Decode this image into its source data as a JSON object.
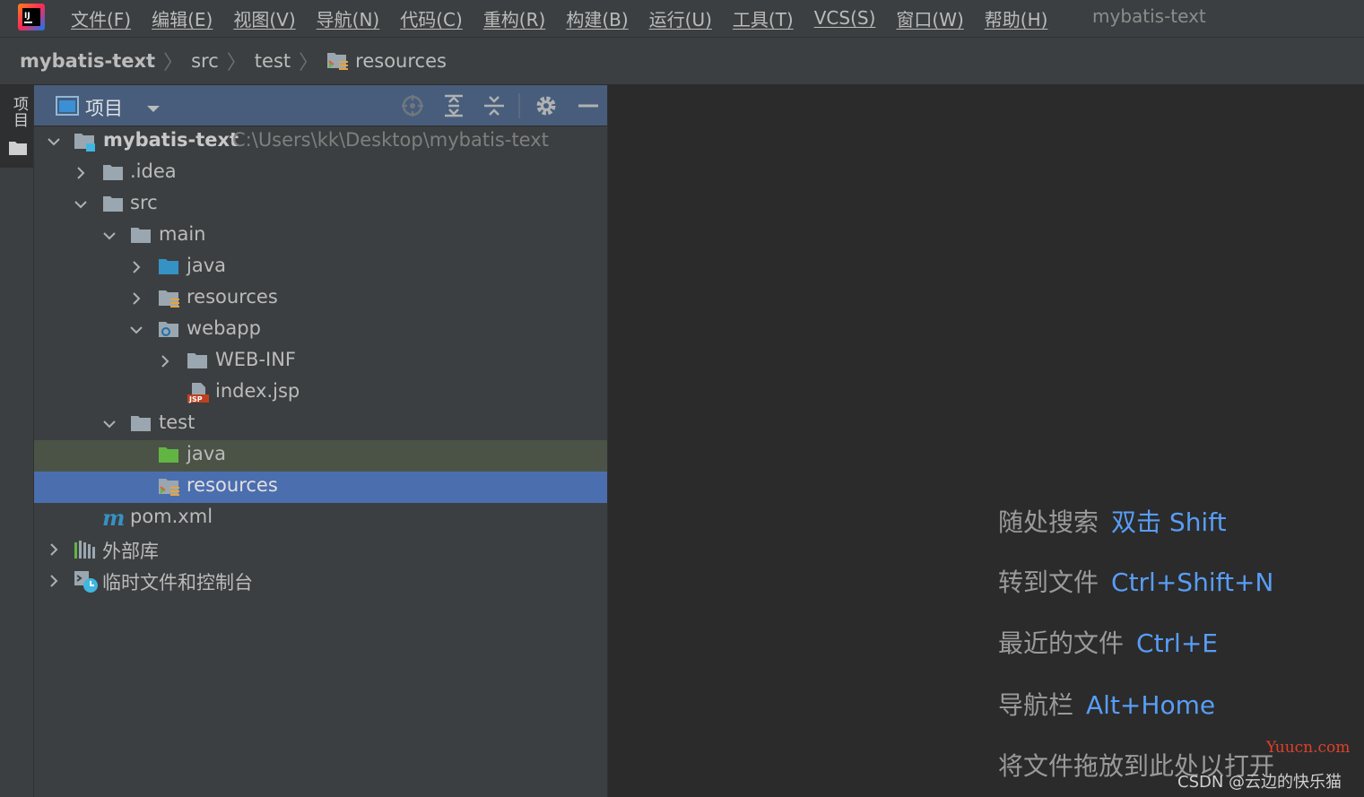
{
  "menubar": {
    "items": [
      "文件(F)",
      "编辑(E)",
      "视图(V)",
      "导航(N)",
      "代码(C)",
      "重构(R)",
      "构建(B)",
      "运行(U)",
      "工具(T)",
      "VCS(S)",
      "窗口(W)",
      "帮助(H)"
    ],
    "window_title": "mybatis-text"
  },
  "breadcrumb": {
    "items": [
      "mybatis-text",
      "src",
      "test",
      "resources"
    ]
  },
  "tool_stripe": {
    "project_label": "项目"
  },
  "project_panel": {
    "title": "项目",
    "tree": [
      {
        "label": "mybatis-text",
        "path": "C:\\Users\\kk\\Desktop\\mybatis-text",
        "icon": "module-folder-icon",
        "expanded": true
      },
      {
        "label": ".idea",
        "icon": "folder-icon",
        "expanded": false
      },
      {
        "label": "src",
        "icon": "folder-icon",
        "expanded": true
      },
      {
        "label": "main",
        "icon": "folder-icon",
        "expanded": true
      },
      {
        "label": "java",
        "icon": "source-folder-icon",
        "expanded": false
      },
      {
        "label": "resources",
        "icon": "resources-folder-icon",
        "expanded": false
      },
      {
        "label": "webapp",
        "icon": "web-folder-icon",
        "expanded": true
      },
      {
        "label": "WEB-INF",
        "icon": "folder-icon",
        "expanded": false
      },
      {
        "label": "index.jsp",
        "icon": "jsp-file-icon"
      },
      {
        "label": "test",
        "icon": "folder-icon",
        "expanded": true
      },
      {
        "label": "java",
        "icon": "test-source-folder-icon",
        "state": "highlighted"
      },
      {
        "label": "resources",
        "icon": "test-resources-folder-icon",
        "state": "selected"
      },
      {
        "label": "pom.xml",
        "icon": "maven-icon"
      },
      {
        "label": "外部库",
        "icon": "library-icon",
        "expanded": false
      },
      {
        "label": "临时文件和控制台",
        "icon": "scratches-icon",
        "expanded": false
      }
    ]
  },
  "editor_hints": [
    {
      "label": "随处搜索",
      "key": "双击 Shift"
    },
    {
      "label": "转到文件",
      "key": "Ctrl+Shift+N"
    },
    {
      "label": "最近的文件",
      "key": "Ctrl+E"
    },
    {
      "label": "导航栏",
      "key": "Alt+Home"
    },
    {
      "label": "将文件拖放到此处以打开",
      "key": ""
    }
  ],
  "watermarks": {
    "site": "Yuucn.com",
    "author": "CSDN @云边的快乐猫"
  },
  "colors": {
    "selection": "#4b6eaf",
    "highlight": "#4b5347",
    "hint_key": "#589df6",
    "header": "#475d7b"
  }
}
